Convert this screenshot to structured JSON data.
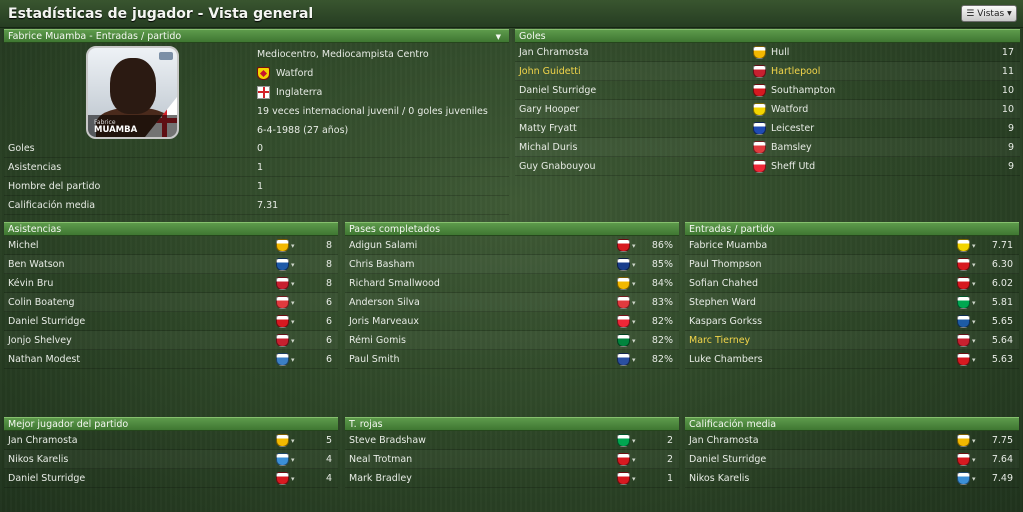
{
  "page": {
    "title": "Estadísticas de jugador - Vista general",
    "views_label": "Vistas"
  },
  "profile": {
    "header": "Fabrice Muamba - Entradas / partido",
    "portrait_first": "Fabrice",
    "portrait_last": "MUAMBA",
    "position": "Mediocentro, Mediocampista Centro",
    "club": "Watford",
    "nation": "Inglaterra",
    "caps": "19 veces internacional juvenil / 0 goles juveniles",
    "dob": "6-4-1988 (27 años)",
    "stats": [
      {
        "label": "Goles",
        "value": "0"
      },
      {
        "label": "Asistencias",
        "value": "1"
      },
      {
        "label": "Hombre del partido",
        "value": "1"
      },
      {
        "label": "Calificación media",
        "value": "7.31"
      }
    ]
  },
  "goals": {
    "header": "Goles",
    "rows": [
      {
        "player": "Jan Chramosta",
        "club": "Hull",
        "value": "17",
        "crest": "#f2b800",
        "hl": false
      },
      {
        "player": "John Guidetti",
        "club": "Hartlepool",
        "value": "11",
        "crest": "#c8202f",
        "hl": true
      },
      {
        "player": "Daniel Sturridge",
        "club": "Southampton",
        "value": "10",
        "crest": "#d71920",
        "hl": false
      },
      {
        "player": "Gary Hooper",
        "club": "Watford",
        "value": "10",
        "crest": "#f3d400",
        "hl": false
      },
      {
        "player": "Matty Fryatt",
        "club": "Leicester",
        "value": "9",
        "crest": "#1f4bb4",
        "hl": false
      },
      {
        "player": "Michal Duris",
        "club": "Bamsley",
        "value": "9",
        "crest": "#e03a3e",
        "hl": false
      },
      {
        "player": "Guy Gnabouyou",
        "club": "Sheff Utd",
        "value": "9",
        "crest": "#ee2737",
        "hl": false
      }
    ]
  },
  "assists": {
    "header": "Asistencias",
    "rows": [
      {
        "player": "Michel",
        "value": "8",
        "crest": "#f2b800",
        "hl": false
      },
      {
        "player": "Ben Watson",
        "value": "8",
        "crest": "#1e5aa8",
        "hl": false
      },
      {
        "player": "Kévin Bru",
        "value": "8",
        "crest": "#c8202f",
        "hl": false
      },
      {
        "player": "Colin Boateng",
        "value": "6",
        "crest": "#e03a3e",
        "hl": false
      },
      {
        "player": "Daniel Sturridge",
        "value": "6",
        "crest": "#d71920",
        "hl": false
      },
      {
        "player": "Jonjo Shelvey",
        "value": "6",
        "crest": "#c8202f",
        "hl": false
      },
      {
        "player": "Nathan Modest",
        "value": "6",
        "crest": "#3b7fc4",
        "hl": false
      }
    ]
  },
  "passes": {
    "header": "Pases completados",
    "rows": [
      {
        "player": "Adigun Salami",
        "value": "86%",
        "crest": "#d71920",
        "hl": false
      },
      {
        "player": "Chris Basham",
        "value": "85%",
        "crest": "#1a3e8c",
        "hl": false
      },
      {
        "player": "Richard Smallwood",
        "value": "84%",
        "crest": "#f2b800",
        "hl": false
      },
      {
        "player": "Anderson Silva",
        "value": "83%",
        "crest": "#e03a3e",
        "hl": false
      },
      {
        "player": "Joris Marveaux",
        "value": "82%",
        "crest": "#ee2737",
        "hl": false
      },
      {
        "player": "Rémi Gomis",
        "value": "82%",
        "crest": "#00843d",
        "hl": false
      },
      {
        "player": "Paul Smith",
        "value": "82%",
        "crest": "#2a4fa0",
        "hl": false
      }
    ]
  },
  "tackles": {
    "header": "Entradas / partido",
    "rows": [
      {
        "player": "Fabrice Muamba",
        "value": "7.71",
        "crest": "#f3d400",
        "hl": false
      },
      {
        "player": "Paul Thompson",
        "value": "6.30",
        "crest": "#d71920",
        "hl": false
      },
      {
        "player": "Sofian Chahed",
        "value": "6.02",
        "crest": "#d71920",
        "hl": false
      },
      {
        "player": "Stephen Ward",
        "value": "5.81",
        "crest": "#00a650",
        "hl": false
      },
      {
        "player": "Kaspars Gorkss",
        "value": "5.65",
        "crest": "#1d5ba4",
        "hl": false
      },
      {
        "player": "Marc Tierney",
        "value": "5.64",
        "crest": "#c8202f",
        "hl": true
      },
      {
        "player": "Luke Chambers",
        "value": "5.63",
        "crest": "#d71920",
        "hl": false
      }
    ]
  },
  "motm": {
    "header": "Mejor jugador del partido",
    "rows": [
      {
        "player": "Jan Chramosta",
        "value": "5",
        "crest": "#f2b800",
        "hl": false
      },
      {
        "player": "Nikos Karelis",
        "value": "4",
        "crest": "#3b8fd6",
        "hl": false
      },
      {
        "player": "Daniel Sturridge",
        "value": "4",
        "crest": "#d71920",
        "hl": false
      }
    ]
  },
  "reds": {
    "header": "T. rojas",
    "rows": [
      {
        "player": "Steve Bradshaw",
        "value": "2",
        "crest": "#00a650",
        "hl": false
      },
      {
        "player": "Neal Trotman",
        "value": "2",
        "crest": "#d71920",
        "hl": false
      },
      {
        "player": "Mark Bradley",
        "value": "1",
        "crest": "#d71920",
        "hl": false
      }
    ]
  },
  "rating": {
    "header": "Calificación media",
    "rows": [
      {
        "player": "Jan Chramosta",
        "value": "7.75",
        "crest": "#f2b800",
        "hl": false
      },
      {
        "player": "Daniel Sturridge",
        "value": "7.64",
        "crest": "#d71920",
        "hl": false
      },
      {
        "player": "Nikos Karelis",
        "value": "7.49",
        "crest": "#3b8fd6",
        "hl": false
      }
    ]
  }
}
